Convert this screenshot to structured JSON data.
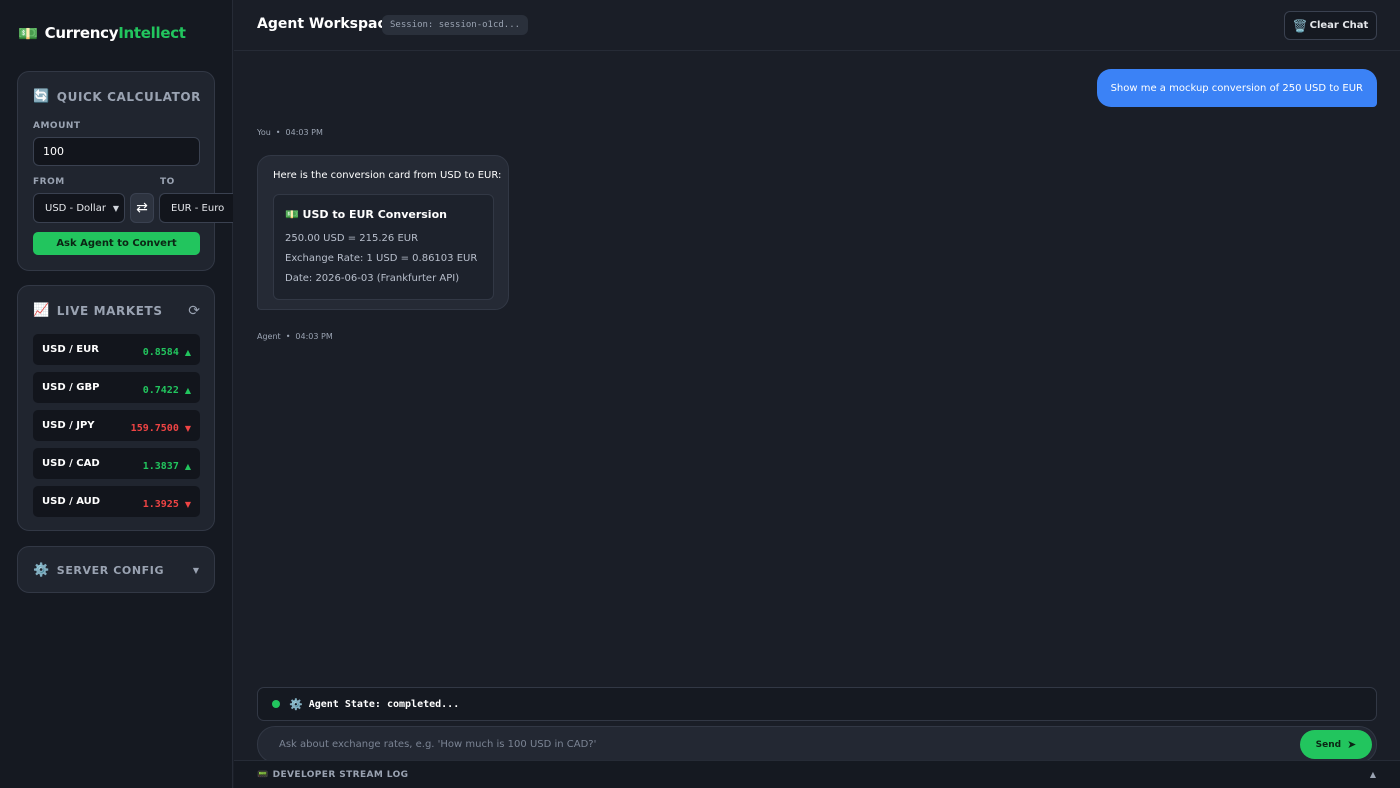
{
  "brand": {
    "emoji": "💵",
    "name_part1": "Currency",
    "name_part2": "Intellect"
  },
  "calculator": {
    "icon": "🔄",
    "title": "QUICK CALCULATOR",
    "amount_label": "AMOUNT",
    "amount_value": "100",
    "from_label": "FROM",
    "to_label": "TO",
    "from_selected": "USD - Dollar",
    "to_selected": "EUR - Euro",
    "swap_icon": "⇄",
    "convert_button": "Ask Agent to Convert"
  },
  "markets": {
    "icon": "📈",
    "title": "LIVE MARKETS",
    "refresh_icon": "⟳",
    "rows": [
      {
        "pair": "USD / EUR",
        "rate": "0.8584",
        "arrow": "▲",
        "trend": "up"
      },
      {
        "pair": "USD / GBP",
        "rate": "0.7422",
        "arrow": "▲",
        "trend": "up"
      },
      {
        "pair": "USD / JPY",
        "rate": "159.7500",
        "arrow": "▼",
        "trend": "down"
      },
      {
        "pair": "USD / CAD",
        "rate": "1.3837",
        "arrow": "▲",
        "trend": "up"
      },
      {
        "pair": "USD / AUD",
        "rate": "1.3925",
        "arrow": "▼",
        "trend": "down"
      }
    ]
  },
  "server_config": {
    "icon": "⚙️",
    "title": "SERVER CONFIG",
    "caret": "▼"
  },
  "header": {
    "title": "Agent Workspace",
    "session": "Session: session-o1cd...",
    "clear_icon": "🗑️",
    "clear_label": "Clear Chat"
  },
  "chat": {
    "user_message": "Show me a mockup conversion of 250 USD to EUR",
    "user_sender": "You",
    "user_time": "04:03 PM",
    "separator": "•",
    "agent_intro": "Here is the conversion card from USD to EUR:",
    "card_title": "💵 USD to EUR Conversion",
    "card_line1": "250.00 USD = 215.26 EUR",
    "card_line2": "Exchange Rate: 1 USD = 0.86103 EUR",
    "card_line3": "Date: 2026-06-03 (Frankfurter API)",
    "agent_sender": "Agent",
    "agent_time": "04:03 PM"
  },
  "agent_state": {
    "icon": "⚙️",
    "text": "Agent State: completed..."
  },
  "composer": {
    "placeholder": "Ask about exchange rates, e.g. 'How much is 100 USD in CAD?'",
    "send_label": "Send",
    "send_icon": "➤"
  },
  "devlog": {
    "icon": "📟",
    "title": "DEVELOPER STREAM LOG",
    "caret": "▲"
  },
  "colors": {
    "accent_green": "#22c55e",
    "user_bubble": "#3b82f6",
    "down_red": "#ef4444"
  }
}
